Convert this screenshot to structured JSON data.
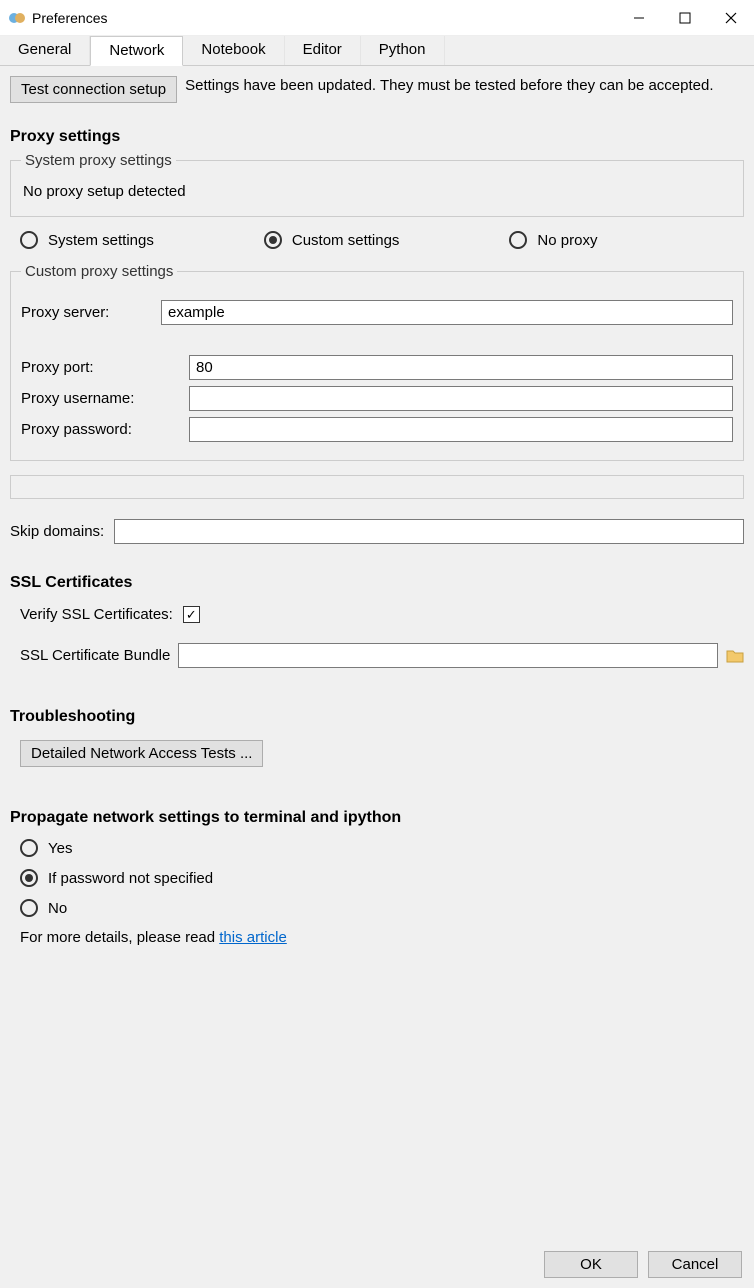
{
  "window": {
    "title": "Preferences"
  },
  "tabs": [
    "General",
    "Network",
    "Notebook",
    "Editor",
    "Python"
  ],
  "active_tab": 1,
  "test_button": "Test connection setup",
  "test_msg": "Settings have been updated. They must be tested before they can be accepted.",
  "proxy_heading": "Proxy settings",
  "system_proxy": {
    "legend": "System proxy settings",
    "text": "No proxy setup detected"
  },
  "proxy_mode": {
    "options": [
      "System settings",
      "Custom settings",
      "No proxy"
    ],
    "selected": 1
  },
  "custom": {
    "legend": "Custom proxy settings",
    "server_label": "Proxy server:",
    "server_value": "example",
    "port_label": "Proxy port:",
    "port_value": "80",
    "user_label": "Proxy username:",
    "user_value": "",
    "pass_label": "Proxy password:",
    "pass_value": ""
  },
  "skip_label": "Skip domains:",
  "skip_value": "",
  "ssl_heading": "SSL Certificates",
  "ssl_verify_label": "Verify SSL Certificates:",
  "ssl_verify_checked": true,
  "ssl_bundle_label": "SSL Certificate Bundle",
  "ssl_bundle_value": "",
  "trouble_heading": "Troubleshooting",
  "trouble_button": "Detailed Network Access Tests ...",
  "propagate_heading": "Propagate network settings to terminal and ipython",
  "propagate": {
    "options": [
      "Yes",
      "If password not specified",
      "No"
    ],
    "selected": 1
  },
  "more_text": "For more details, please read ",
  "more_link": "this article",
  "footer": {
    "ok": "OK",
    "cancel": "Cancel"
  }
}
